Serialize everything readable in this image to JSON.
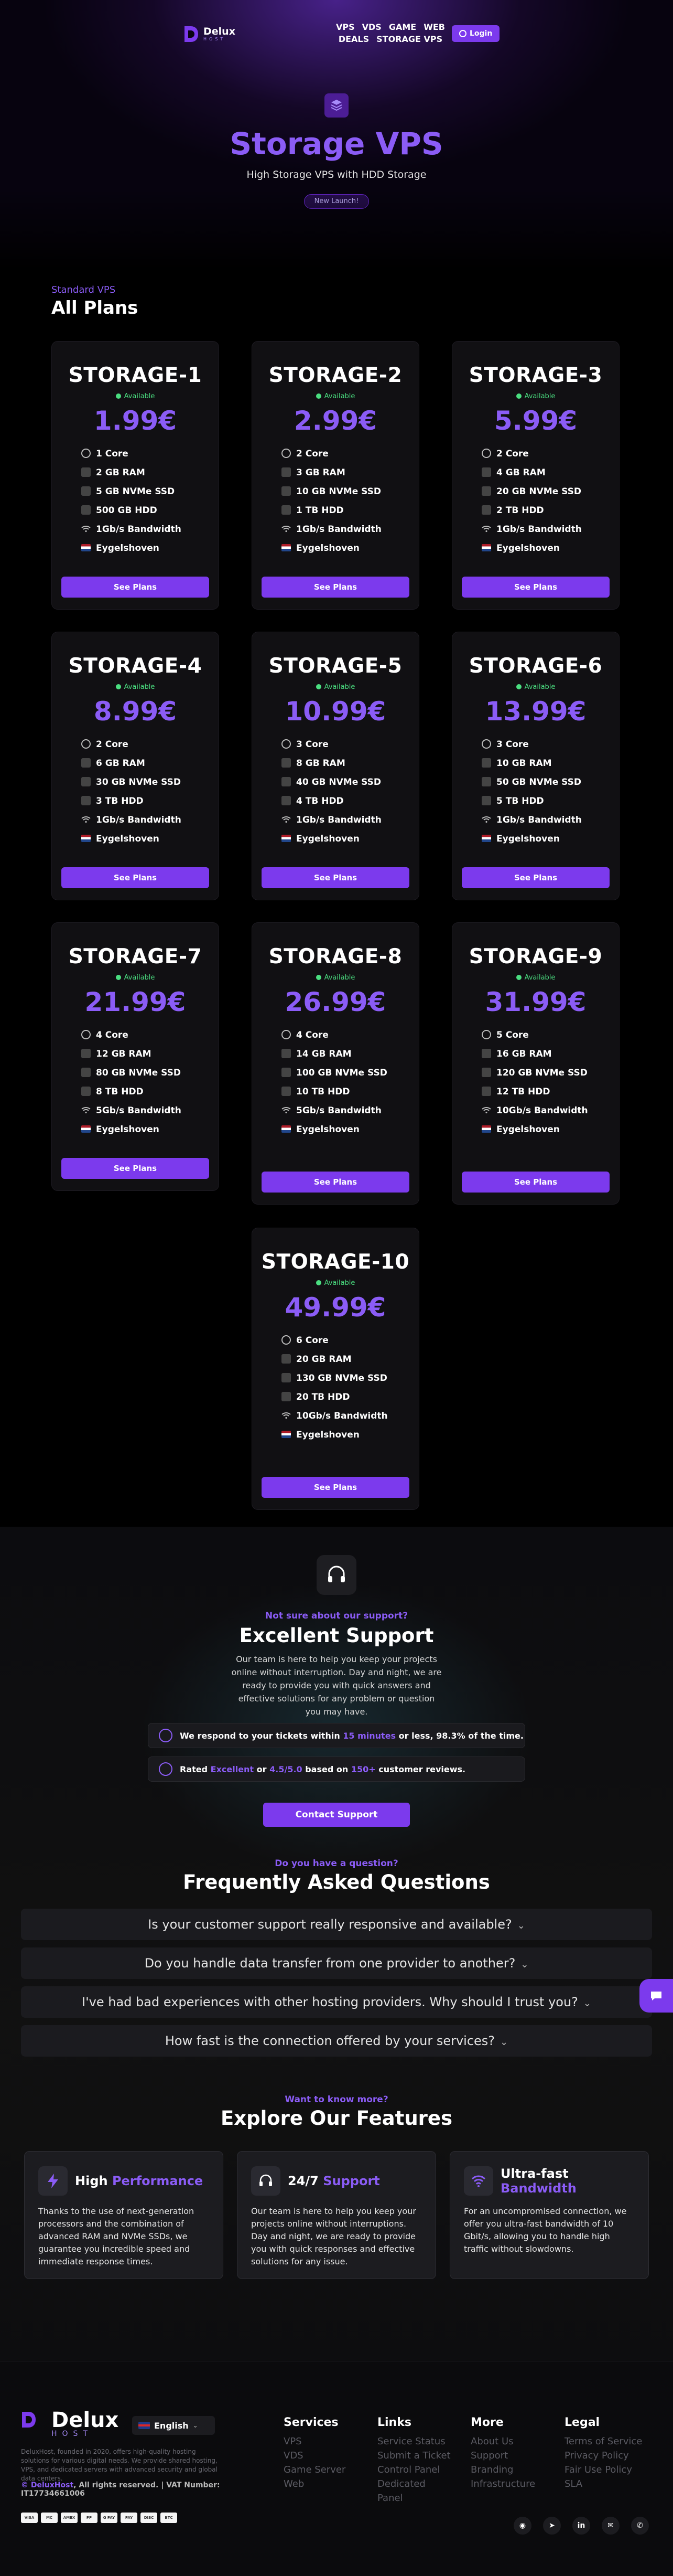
{
  "nav": {
    "logo_text": "Delux",
    "logo_sub": "HOST",
    "links": [
      "VPS",
      "VDS",
      "GAME",
      "WEB",
      "DEALS",
      "STORAGE VPS"
    ],
    "login_label": "Login"
  },
  "hero": {
    "title": "Storage VPS",
    "subtitle": "High Storage VPS with HDD Storage",
    "badge": "New Launch!"
  },
  "plans_section": {
    "kicker": "Standard VPS",
    "title": "All Plans"
  },
  "plans": [
    {
      "name": "STORAGE-1",
      "status": "Available",
      "price": "1.99€",
      "cpu": "1 Core",
      "ram": "2 GB RAM",
      "ssd": "5 GB NVMe SSD",
      "hdd": "500 GB HDD",
      "bandwidth": "1Gb/s Bandwidth",
      "location": "Eygelshoven",
      "button": "See Plans"
    },
    {
      "name": "STORAGE-2",
      "status": "Available",
      "price": "2.99€",
      "cpu": "2 Core",
      "ram": "3 GB RAM",
      "ssd": "10 GB NVMe SSD",
      "hdd": "1 TB HDD",
      "bandwidth": "1Gb/s Bandwidth",
      "location": "Eygelshoven",
      "button": "See Plans"
    },
    {
      "name": "STORAGE-3",
      "status": "Available",
      "price": "5.99€",
      "cpu": "2 Core",
      "ram": "4 GB RAM",
      "ssd": "20 GB NVMe SSD",
      "hdd": "2 TB HDD",
      "bandwidth": "1Gb/s Bandwidth",
      "location": "Eygelshoven",
      "button": "See Plans"
    },
    {
      "name": "STORAGE-4",
      "status": "Available",
      "price": "8.99€",
      "cpu": "2 Core",
      "ram": "6 GB RAM",
      "ssd": "30 GB NVMe SSD",
      "hdd": "3 TB HDD",
      "bandwidth": "1Gb/s Bandwidth",
      "location": "Eygelshoven",
      "button": "See Plans"
    },
    {
      "name": "STORAGE-5",
      "status": "Available",
      "price": "10.99€",
      "cpu": "3 Core",
      "ram": "8 GB RAM",
      "ssd": "40 GB NVMe SSD",
      "hdd": "4 TB HDD",
      "bandwidth": "1Gb/s Bandwidth",
      "location": "Eygelshoven",
      "button": "See Plans"
    },
    {
      "name": "STORAGE-6",
      "status": "Available",
      "price": "13.99€",
      "cpu": "3 Core",
      "ram": "10 GB RAM",
      "ssd": "50 GB NVMe SSD",
      "hdd": "5 TB HDD",
      "bandwidth": "1Gb/s Bandwidth",
      "location": "Eygelshoven",
      "button": "See Plans"
    },
    {
      "name": "STORAGE-7",
      "status": "Available",
      "price": "21.99€",
      "cpu": "4 Core",
      "ram": "12 GB RAM",
      "ssd": "80 GB NVMe SSD",
      "hdd": "8 TB HDD",
      "bandwidth": "5Gb/s Bandwidth",
      "location": "Eygelshoven",
      "button": "See Plans"
    },
    {
      "name": "STORAGE-8",
      "status": "Available",
      "price": "26.99€",
      "cpu": "4 Core",
      "ram": "14 GB RAM",
      "ssd": "100 GB NVMe SSD",
      "hdd": "10 TB HDD",
      "bandwidth": "5Gb/s Bandwidth",
      "location": "Eygelshoven",
      "button": "See Plans"
    },
    {
      "name": "STORAGE-9",
      "status": "Available",
      "price": "31.99€",
      "cpu": "5 Core",
      "ram": "16 GB RAM",
      "ssd": "120 GB NVMe SSD",
      "hdd": "12 TB HDD",
      "bandwidth": "10Gb/s Bandwidth",
      "location": "Eygelshoven",
      "button": "See Plans"
    },
    {
      "name": "STORAGE-10",
      "status": "Available",
      "price": "49.99€",
      "cpu": "6 Core",
      "ram": "20 GB RAM",
      "ssd": "130 GB NVMe SSD",
      "hdd": "20 TB HDD",
      "bandwidth": "10Gb/s Bandwidth",
      "location": "Eygelshoven",
      "button": "See Plans"
    }
  ],
  "support": {
    "kicker": "Not sure about our support?",
    "title": "Excellent Support",
    "description": "Our team is here to help you keep your projects online without interruption. Day and night, we are ready to provide you with quick answers and effective solutions for any problem or question you may have.",
    "stat1": {
      "pre": "We respond to your tickets within ",
      "hl": "15 minutes",
      "post": " or less, 98.3% of the time."
    },
    "stat2": {
      "pre": "Rated ",
      "hl1": "Excellent",
      "mid1": " or ",
      "hl2": "4.5/5.0",
      "mid2": " based on ",
      "hl3": "150+",
      "post": " customer reviews."
    },
    "contact_button": "Contact Support"
  },
  "faq": {
    "kicker": "Do you have a question?",
    "title": "Frequently Asked Questions",
    "items": [
      "Is your customer support really responsive and available?",
      "Do you handle data transfer from one provider to another?",
      "I've had bad experiences with other hosting providers. Why should I trust you?",
      "How fast is the connection offered by your services?"
    ]
  },
  "features": {
    "kicker": "Want to know more?",
    "title": "Explore Our Features",
    "items": [
      {
        "title_a": "High ",
        "title_b": "Performance",
        "text": "Thanks to the use of next-generation processors and the combination of advanced RAM and NVMe SSDs, we guarantee you incredible speed and immediate response times.",
        "icon": "lightning-icon"
      },
      {
        "title_a": "24/7 ",
        "title_b": "Support",
        "text": "Our team is here to help you keep your projects online without interruptions. Day and night, we are ready to provide you with quick responses and effective solutions for any issue.",
        "icon": "headset-icon"
      },
      {
        "title_a": "Ultra-fast ",
        "title_b": "Bandwidth",
        "text": "For an uncompromised connection, we offer you ultra-fast bandwidth of 10 Gbit/s, allowing you to handle high traffic without slowdowns.",
        "icon": "wifi-icon"
      }
    ]
  },
  "footer": {
    "logo_text": "Delux",
    "logo_sub": "HOST",
    "language": "English",
    "about": "DeluxHost, founded in 2020, offers high-quality hosting solutions for various digital needs. We provide shared hosting, VPS, and dedicated servers with advanced security and global data centers.",
    "copyright_brand": "© DeluxHost",
    "copyright_rest": ", All rights reserved. | VAT Number: IT17734661006",
    "payments": [
      "VISA",
      "MC",
      "AMEX",
      "PP",
      "G PAY",
      "PAY",
      "DISC",
      "BTC"
    ],
    "columns": [
      {
        "title": "Services",
        "links": [
          "VPS",
          "VDS",
          "Game Server",
          "Web"
        ]
      },
      {
        "title": "Links",
        "links": [
          "Service Status",
          "Submit a Ticket",
          "Control Panel",
          "Dedicated Panel"
        ]
      },
      {
        "title": "More",
        "links": [
          "About Us",
          "Support",
          "Branding",
          "Infrastructure"
        ]
      },
      {
        "title": "Legal",
        "links": [
          "Terms of Service",
          "Privacy Policy",
          "Fair Use Policy",
          "SLA"
        ]
      }
    ],
    "socials": [
      "discord-icon",
      "telegram-icon",
      "linkedin-icon",
      "email-icon",
      "whatsapp-icon"
    ]
  },
  "colors": {
    "accent": "#7c3aed",
    "accent_text": "#8b5cf6",
    "available": "#4ade80"
  }
}
